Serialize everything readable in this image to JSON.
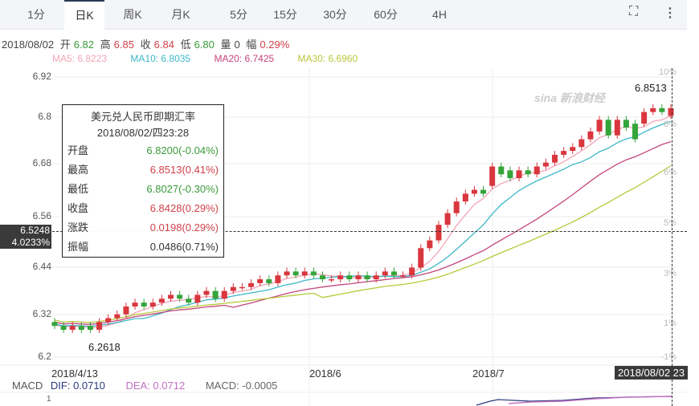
{
  "tabs": [
    "1分",
    "日K",
    "周K",
    "月K",
    "5分",
    "15分",
    "30分",
    "60分",
    "4H"
  ],
  "active_tab": "日K",
  "icons": {
    "fullscreen": "fullscreen-icon",
    "more": "more-vertical-icon"
  },
  "info": {
    "date": "2018/08/02",
    "open_label": "开",
    "open": "6.82",
    "high_label": "高",
    "high": "6.85",
    "close_label": "收",
    "close": "6.84",
    "low_label": "低",
    "low": "6.80",
    "vol_label": "量",
    "vol": "0",
    "amp_label": "幅",
    "amp": "0.29%"
  },
  "ma": {
    "ma5": "MA5: 6.8223",
    "ma10": "MA10: 6.8035",
    "ma20": "MA20: 6.7425",
    "ma30": "MA30: 6.6960"
  },
  "colors": {
    "up": "#d9363e",
    "down": "#35a43a",
    "ma5": "#f2a6b8",
    "ma10": "#3cb8c8",
    "ma20": "#c4457c",
    "ma30": "#b8c83a"
  },
  "tooltip": {
    "title": "美元兑人民币即期汇率",
    "datetime": "2018/08/02/四23:28",
    "rows": [
      {
        "label": "开盘",
        "value": "6.8200(-0.04%)",
        "color": "g"
      },
      {
        "label": "最高",
        "value": "6.8513(0.41%)",
        "color": "r"
      },
      {
        "label": "最低",
        "value": "6.8027(-0.30%)",
        "color": "g"
      },
      {
        "label": "收盘",
        "value": "6.8428(0.29%)",
        "color": "r"
      },
      {
        "label": "涨跌",
        "value": "0.0198(0.29%)",
        "color": "r"
      },
      {
        "label": "振幅",
        "value": "0.0486(0.71%)",
        "color": ""
      }
    ]
  },
  "crosshair": {
    "price": "6.5248",
    "pct": "4.0233%",
    "date": "2018/08/02 23"
  },
  "annotations": {
    "max": "6.8513",
    "min": "6.2618"
  },
  "watermark": "sina 新浪财经",
  "macd": {
    "label": "MACD",
    "dif": "DIF: 0.0710",
    "dea": "DEA: 0.0712",
    "macd": "MACD: -0.0005",
    "axis_tick": "1"
  },
  "chart_data": {
    "type": "candlestick",
    "y_ticks": [
      "6.92",
      "6.8",
      "6.68",
      "6.56",
      "6.44",
      "6.32",
      "6.2"
    ],
    "ylim": [
      6.2,
      6.92
    ],
    "pct_ticks": [
      "10%",
      "8%",
      "6%",
      "5%",
      "3%",
      "1%",
      "-1%"
    ],
    "x_labels": [
      "2018/4/13",
      "2018/6",
      "2018/7"
    ],
    "open": [
      6.29,
      6.28,
      6.27,
      6.28,
      6.28,
      6.27,
      6.29,
      6.3,
      6.31,
      6.33,
      6.34,
      6.33,
      6.34,
      6.35,
      6.36,
      6.35,
      6.34,
      6.36,
      6.37,
      6.35,
      6.37,
      6.38,
      6.38,
      6.39,
      6.4,
      6.39,
      6.41,
      6.42,
      6.41,
      6.42,
      6.41,
      6.4,
      6.4,
      6.41,
      6.4,
      6.41,
      6.4,
      6.41,
      6.42,
      6.41,
      6.41,
      6.43,
      6.48,
      6.5,
      6.54,
      6.57,
      6.6,
      6.62,
      6.63,
      6.64,
      6.69,
      6.68,
      6.66,
      6.68,
      6.67,
      6.69,
      6.7,
      6.72,
      6.73,
      6.74,
      6.76,
      6.78,
      6.81,
      6.77,
      6.81,
      6.8,
      6.8,
      6.83,
      6.84,
      6.82
    ],
    "close": [
      6.28,
      6.27,
      6.28,
      6.27,
      6.27,
      6.29,
      6.3,
      6.31,
      6.33,
      6.34,
      6.33,
      6.34,
      6.35,
      6.36,
      6.35,
      6.34,
      6.36,
      6.37,
      6.35,
      6.37,
      6.38,
      6.38,
      6.39,
      6.4,
      6.39,
      6.41,
      6.42,
      6.41,
      6.42,
      6.41,
      6.4,
      6.4,
      6.41,
      6.4,
      6.41,
      6.4,
      6.41,
      6.42,
      6.41,
      6.41,
      6.43,
      6.48,
      6.5,
      6.54,
      6.57,
      6.6,
      6.62,
      6.63,
      6.62,
      6.69,
      6.67,
      6.66,
      6.68,
      6.67,
      6.69,
      6.7,
      6.72,
      6.73,
      6.74,
      6.76,
      6.78,
      6.81,
      6.77,
      6.81,
      6.79,
      6.76,
      6.83,
      6.84,
      6.83,
      6.84
    ]
  }
}
